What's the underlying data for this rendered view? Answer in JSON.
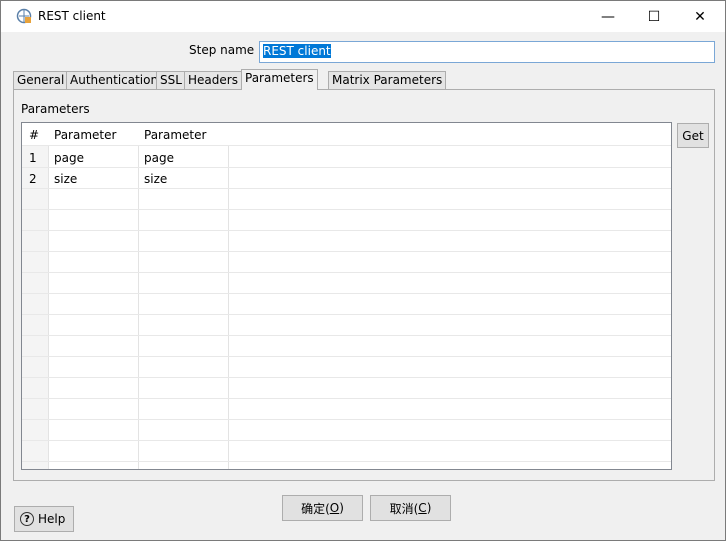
{
  "window": {
    "title": "REST client",
    "minimize_glyph": "—",
    "maximize_glyph": "☐",
    "close_glyph": "✕"
  },
  "step_name": {
    "label": "Step name",
    "value": "REST client"
  },
  "tabs": [
    {
      "label": "General"
    },
    {
      "label": "Authentication"
    },
    {
      "label": "SSL"
    },
    {
      "label": "Headers"
    },
    {
      "label": "Parameters",
      "active": true
    },
    {
      "label": "Matrix Parameters"
    }
  ],
  "parameters": {
    "section_label": "Parameters",
    "columns": [
      "#",
      "Parameter",
      "Parameter"
    ],
    "sort_glyph": "^",
    "rows": [
      {
        "num": "1",
        "field": "page",
        "parameter": "page"
      },
      {
        "num": "2",
        "field": "size",
        "parameter": "size"
      }
    ]
  },
  "buttons": {
    "get": "Get",
    "ok": "确定(O)",
    "ok_prefix": "确定(",
    "ok_key": "O",
    "ok_suffix": ")",
    "cancel_prefix": "取消(",
    "cancel_key": "C",
    "cancel_suffix": ")",
    "help": "Help",
    "help_glyph": "?"
  }
}
